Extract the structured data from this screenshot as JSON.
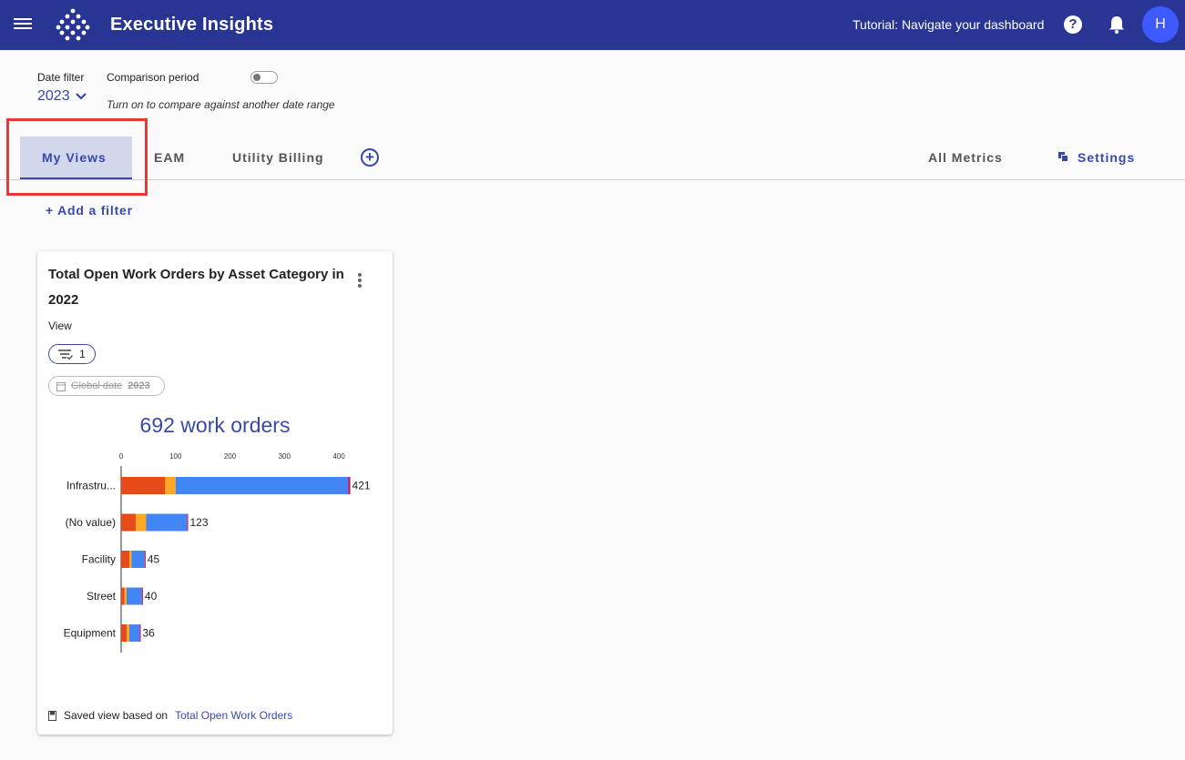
{
  "app": {
    "title": "Executive Insights",
    "tutorial_label": "Tutorial: Navigate your dashboard",
    "help_glyph": "?",
    "avatar_initial": "H"
  },
  "date_filter": {
    "label": "Date filter",
    "value": "2023"
  },
  "comparison": {
    "label": "Comparison period",
    "enabled": false,
    "hint": "Turn on to compare against another date range"
  },
  "tabs": [
    {
      "label": "My Views",
      "active": true
    },
    {
      "label": "EAM",
      "active": false
    },
    {
      "label": "Utility Billing",
      "active": false
    }
  ],
  "right_tabs": {
    "all_metrics": "All Metrics",
    "settings": "Settings"
  },
  "add_filter_label": "+ Add a filter",
  "card": {
    "title": "Total Open Work Orders by Asset Category in 2022",
    "subtitle": "View",
    "filter_count": "1",
    "global_date_label": "Global date",
    "global_date_value": "2023",
    "headline": "692 work orders",
    "footer_text": "Saved view based on",
    "footer_link": "Total Open Work Orders"
  },
  "chart_data": {
    "type": "bar",
    "orientation": "horizontal",
    "stacked": true,
    "x_ticks": [
      "0",
      "100",
      "200",
      "300",
      "400"
    ],
    "xlim": [
      0,
      420
    ],
    "categories": [
      "Infrastru...",
      "(No value)",
      "Facility",
      "Street",
      "Equipment"
    ],
    "totals": [
      421,
      123,
      45,
      40,
      36
    ],
    "series": [
      {
        "color": "#e64a19",
        "values": [
          81,
          27,
          15,
          6,
          10
        ]
      },
      {
        "color": "#ffa726",
        "values": [
          19,
          19,
          4,
          4,
          5
        ]
      },
      {
        "color": "#4285f4",
        "values": [
          317,
          75,
          24,
          28,
          19
        ]
      },
      {
        "color": "#c2185b",
        "values": [
          4,
          2,
          2,
          2,
          2
        ]
      }
    ]
  }
}
